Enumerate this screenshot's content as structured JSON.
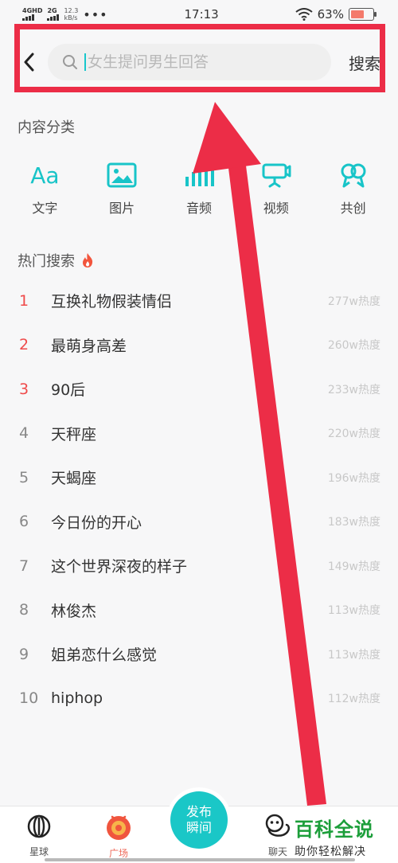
{
  "status_bar": {
    "network_1": "4GHD",
    "network_2": "2G",
    "speed": "12.3",
    "speed_unit": "kB/s",
    "more": "•••",
    "time": "17:13",
    "battery": "63%",
    "battery_level": 0.63
  },
  "search": {
    "placeholder": "女生提问男生回答",
    "button_label": "搜索"
  },
  "categories_section": {
    "title": "内容分类",
    "items": [
      {
        "label": "文字",
        "icon": "Aa"
      },
      {
        "label": "图片",
        "icon": "image-icon"
      },
      {
        "label": "音频",
        "icon": "audio-icon"
      },
      {
        "label": "视频",
        "icon": "video-icon"
      },
      {
        "label": "共创",
        "icon": "co-create-icon"
      }
    ]
  },
  "hot_section": {
    "title": "热门搜索",
    "items": [
      {
        "rank": "1",
        "term": "互换礼物假装情侣",
        "heat": "277w热度"
      },
      {
        "rank": "2",
        "term": "最萌身高差",
        "heat": "260w热度"
      },
      {
        "rank": "3",
        "term": "90后",
        "heat": "233w热度"
      },
      {
        "rank": "4",
        "term": "天秤座",
        "heat": "220w热度"
      },
      {
        "rank": "5",
        "term": "天蝎座",
        "heat": "196w热度"
      },
      {
        "rank": "6",
        "term": "今日份的开心",
        "heat": "183w热度"
      },
      {
        "rank": "7",
        "term": "这个世界深夜的样子",
        "heat": "149w热度"
      },
      {
        "rank": "8",
        "term": "林俊杰",
        "heat": "113w热度"
      },
      {
        "rank": "9",
        "term": "姐弟恋什么感觉",
        "heat": "113w热度"
      },
      {
        "rank": "10",
        "term": "hiphop",
        "heat": "112w热度"
      }
    ]
  },
  "bottom_nav": {
    "planet": "星球",
    "square": "广场",
    "publish_line1": "发布",
    "publish_line2": "瞬间",
    "chat": "聊天"
  },
  "watermark": {
    "title": "百科全说",
    "subtitle": "助你轻松解决"
  },
  "colors": {
    "accent": "#18c4c8",
    "rank_top": "#ef4a4a",
    "annotation": "#ec2d47"
  }
}
